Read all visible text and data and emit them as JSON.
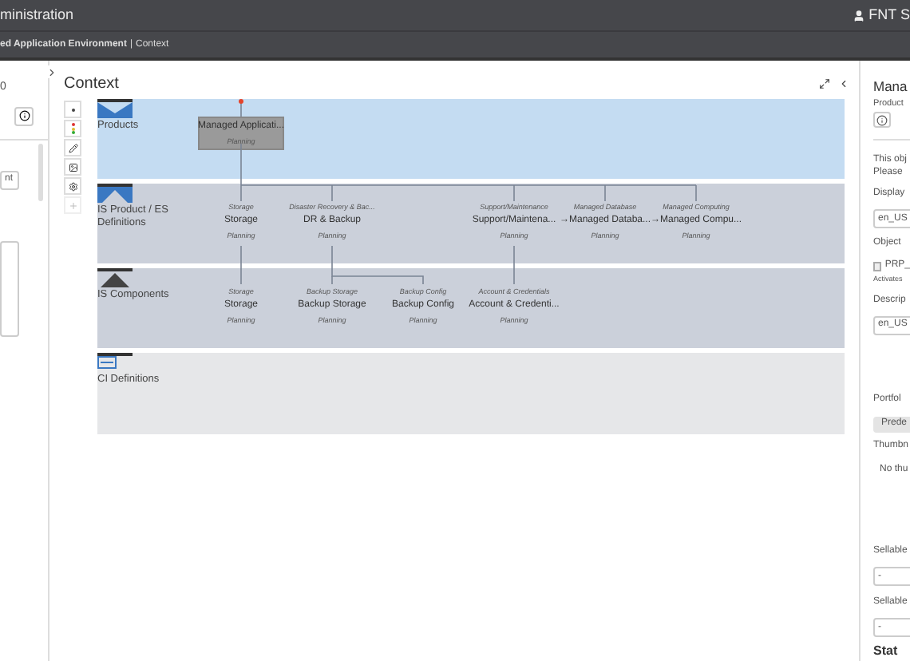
{
  "header": {
    "title": "ministration",
    "user": "FNT S"
  },
  "breadcrumb": {
    "path": "ed Application Environment",
    "separator": "|",
    "current": "Context"
  },
  "left_panel": {
    "heading": "0",
    "field_value": "nt"
  },
  "center": {
    "title": "Context",
    "lanes": [
      {
        "kind": "products",
        "label": "Products",
        "nodes": [
          {
            "name": "Managed Applicati...",
            "status": "Planning",
            "selected": true
          }
        ]
      },
      {
        "kind": "es",
        "label": "IS Product / ES Definitions",
        "nodes": [
          {
            "category": "Storage",
            "name": "Storage",
            "status": "Planning",
            "selected": false
          },
          {
            "category": "Disaster Recovery & Bac...",
            "name": "DR & Backup",
            "status": "Planning",
            "selected": false
          },
          {
            "category": "Support/Maintenance",
            "name": "Support/Maintena...",
            "status": "Planning",
            "selected": false
          },
          {
            "category": "Managed Database",
            "name": "→Managed Databa...",
            "status": "Planning",
            "selected": false
          },
          {
            "category": "Managed Computing",
            "name": "→Managed Compu...",
            "status": "Planning",
            "selected": false
          }
        ]
      },
      {
        "kind": "components",
        "label": "IS Components",
        "nodes": [
          {
            "category": "Storage",
            "name": "Storage",
            "status": "Planning",
            "selected": false
          },
          {
            "category": "Backup Storage",
            "name": "Backup Storage",
            "status": "Planning",
            "selected": false
          },
          {
            "category": "Backup Config",
            "name": "Backup Config",
            "status": "Planning",
            "selected": false
          },
          {
            "category": "Account & Credentials",
            "name": "Account & Credenti...",
            "status": "Planning",
            "selected": false
          }
        ]
      },
      {
        "kind": "ci",
        "label": "CI Definitions"
      }
    ]
  },
  "right_panel": {
    "title": "Mana",
    "subtitle": "Product",
    "notice": [
      "This obj",
      "Please"
    ],
    "display_label": "Display",
    "display_value": "en_US",
    "object_label": "Object",
    "checkbox": {
      "label": "PRP_",
      "checked": false
    },
    "checkbox_hint": "Activates",
    "description_label": "Descrip",
    "description_value": "en_US",
    "portfolio_label": "Portfol",
    "portfolio_button": "Prede",
    "thumbnail_label": "Thumbn",
    "thumbnail_empty": "No thu",
    "sellable": [
      {
        "label": "Sellable",
        "value": "-"
      },
      {
        "label": "Sellable",
        "value": "-"
      }
    ],
    "status_heading": "Stat"
  }
}
